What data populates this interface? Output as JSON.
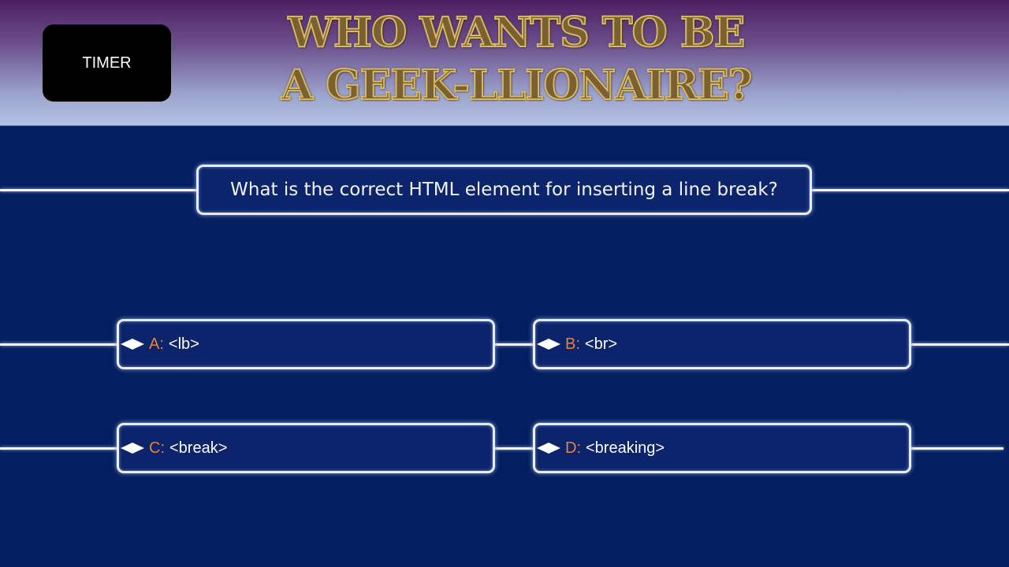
{
  "header": {
    "timer_label": "TIMER",
    "title_line1": "WHO WANTS TO BE",
    "title_line2": "A GEEK-LLIONAIRE?"
  },
  "question": {
    "text": "What is the correct HTML element for inserting a line break?"
  },
  "answers": [
    {
      "letter": "A:",
      "text": "<lb>"
    },
    {
      "letter": "B:",
      "text": "<br>"
    },
    {
      "letter": "C:",
      "text": "<break>"
    },
    {
      "letter": "D:",
      "text": "<breaking>"
    }
  ],
  "colors": {
    "background": "#031f5f",
    "answer_letter": "#e8823b",
    "title_gold": "#7b6030"
  }
}
